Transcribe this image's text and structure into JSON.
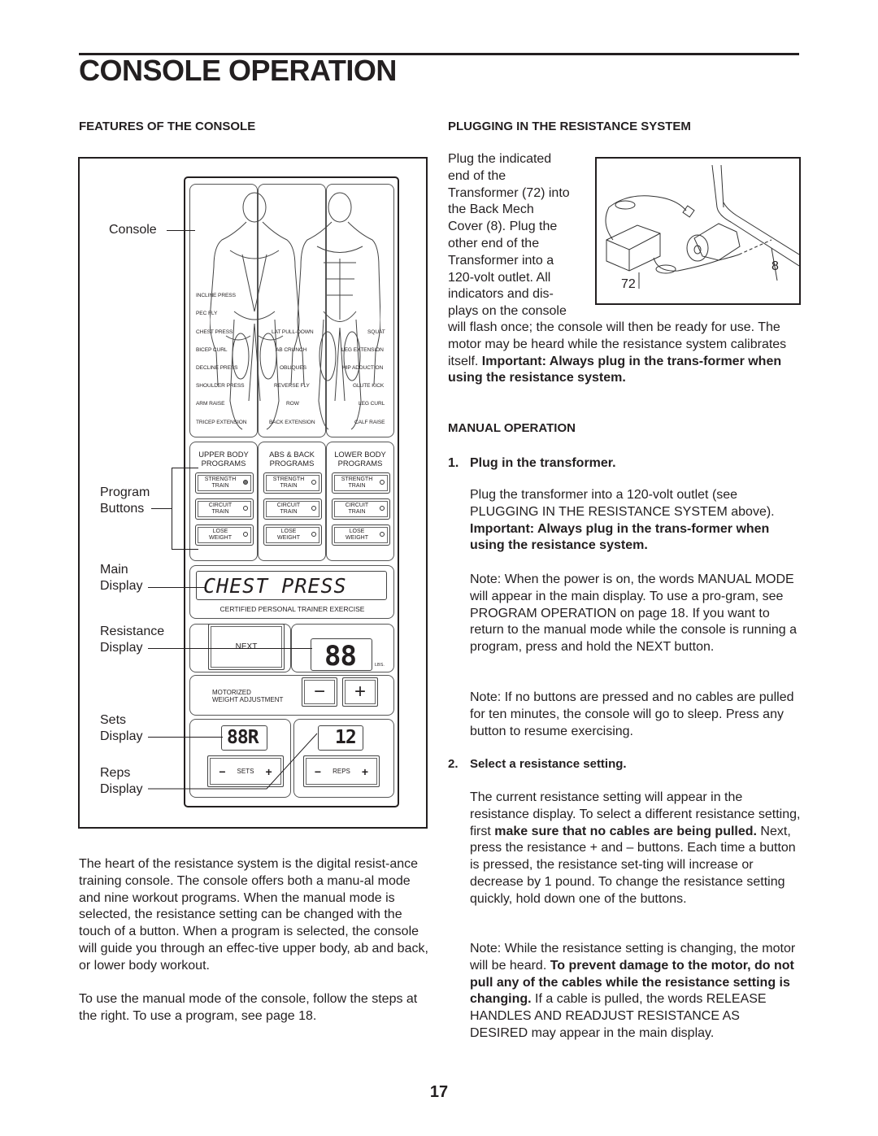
{
  "page": {
    "title": "CONSOLE OPERATION",
    "page_number": "17"
  },
  "features": {
    "heading": "FEATURES OF THE CONSOLE",
    "callouts": {
      "console": "Console",
      "program_buttons": [
        "Program",
        "Buttons"
      ],
      "main_display": [
        "Main",
        "Display"
      ],
      "resistance_display": [
        "Resistance",
        "Display"
      ],
      "sets_display": [
        "Sets",
        "Display"
      ],
      "reps_display": [
        "Reps",
        "Display"
      ]
    },
    "exercises": {
      "left": [
        "INCLINE PRESS",
        "PEC FLY",
        "CHEST PRESS",
        "BICEP CURL",
        "DECLINE PRESS",
        "SHOULDER PRESS",
        "ARM RAISE",
        "TRICEP EXTENSION"
      ],
      "center": [
        "LAT PULL-DOWN",
        "AB CRUNCH",
        "OBLIQUES",
        "REVERSE FLY",
        "ROW",
        "BACK EXTENSION"
      ],
      "right": [
        "SQUAT",
        "LEG EXTENSION",
        "HIP ADDUCTION",
        "GLUTE KICK",
        "LEG CURL",
        "CALF RAISE"
      ]
    },
    "programs": [
      {
        "heading": [
          "UPPER BODY",
          "PROGRAMS"
        ],
        "buttons": [
          {
            "label": [
              "STRENGTH",
              "TRAIN"
            ],
            "led_on": true
          },
          {
            "label": [
              "CIRCUIT",
              "TRAIN"
            ],
            "led_on": false
          },
          {
            "label": [
              "LOSE",
              "WEIGHT"
            ],
            "led_on": false
          }
        ]
      },
      {
        "heading": [
          "ABS & BACK",
          "PROGRAMS"
        ],
        "buttons": [
          {
            "label": [
              "STRENGTH",
              "TRAIN"
            ],
            "led_on": false
          },
          {
            "label": [
              "CIRCUIT",
              "TRAIN"
            ],
            "led_on": false
          },
          {
            "label": [
              "LOSE",
              "WEIGHT"
            ],
            "led_on": false
          }
        ]
      },
      {
        "heading": [
          "LOWER BODY",
          "PROGRAMS"
        ],
        "buttons": [
          {
            "label": [
              "STRENGTH",
              "TRAIN"
            ],
            "led_on": false
          },
          {
            "label": [
              "CIRCUIT",
              "TRAIN"
            ],
            "led_on": false
          },
          {
            "label": [
              "LOSE",
              "WEIGHT"
            ],
            "led_on": false
          }
        ]
      }
    ],
    "main_display_text": "CHEST PRESS",
    "main_display_caption": "CERTIFIED PERSONAL TRAINER EXERCISE",
    "next_button": "NEXT",
    "resistance_value": "88",
    "resistance_unit": "LBS.",
    "motorized_label": [
      "MOTORIZED",
      "WEIGHT ADJUSTMENT"
    ],
    "minus_glyph": "−",
    "plus_glyph": "+",
    "sets_value": "88R",
    "reps_value": "12",
    "sets_label": "SETS",
    "reps_label": "REPS",
    "paragraphs": [
      "The heart of the resistance system is the digital resist-ance training console. The console offers both a manu-al mode and nine workout programs. When the manual mode is selected, the resistance setting can be changed with the touch of a button. When a program is selected, the console will guide you through an effec-tive upper body, ab and back, or lower body workout.",
      "To use the manual mode of the console, follow the steps at the right. To use a program, see page 18."
    ]
  },
  "plugging": {
    "heading": "PLUGGING IN THE RESISTANCE SYSTEM",
    "wrapped_lines": [
      "Plug the indicated",
      "end of the",
      "Transformer (72) into",
      "the Back Mech",
      "Cover (8). Plug the",
      "other end of the",
      "Transformer into a",
      "120-volt outlet. All",
      "indicators and dis-",
      "plays on the console"
    ],
    "cont_normal": "will flash once; the console will then be ready for use. The motor may be heard while the resistance system calibrates itself. ",
    "cont_bold": "Important: Always plug in the trans-former when using the resistance system.",
    "diagram_labels": {
      "transformer": "72",
      "back_mech_cover": "8"
    }
  },
  "manual": {
    "heading": "MANUAL OPERATION",
    "step1": {
      "num": "1.",
      "title": "Plug in the transformer.",
      "p1_normal": "Plug the transformer into a 120-volt outlet (see PLUGGING IN THE RESISTANCE SYSTEM above). ",
      "p1_bold": "Important: Always plug in the trans-former when using the resistance system.",
      "note1": "Note: When the power is on, the words MANUAL MODE will appear in the main display. To use a pro-gram, see PROGRAM OPERATION on page 18. If you want to return to the manual mode while the console is running a program, press and hold the NEXT button.",
      "note2": "Note: If no buttons are pressed and no cables are pulled for ten minutes, the console will go to sleep. Press any button to resume exercising."
    },
    "step2": {
      "num": "2.",
      "title": "Select a resistance setting.",
      "p_a": "The current resistance setting will appear in the resistance display. To select a different resistance setting, first ",
      "p_b_bold": "make sure that no cables are being pulled.",
      "p_c": " Next, press the resistance + and – buttons. Each time a button is pressed, the resistance set-ting will increase or decrease by 1 pound. To change the resistance setting quickly, hold down one of the buttons.",
      "note_a": "Note: While the resistance setting is changing, the motor will be heard. ",
      "note_b_bold": "To prevent damage to the motor, do not pull any of the cables while the resistance setting is changing.",
      "note_c": " If a cable is pulled, the words RELEASE HANDLES AND READJUST RESISTANCE AS DESIRED may appear in the main display."
    }
  }
}
